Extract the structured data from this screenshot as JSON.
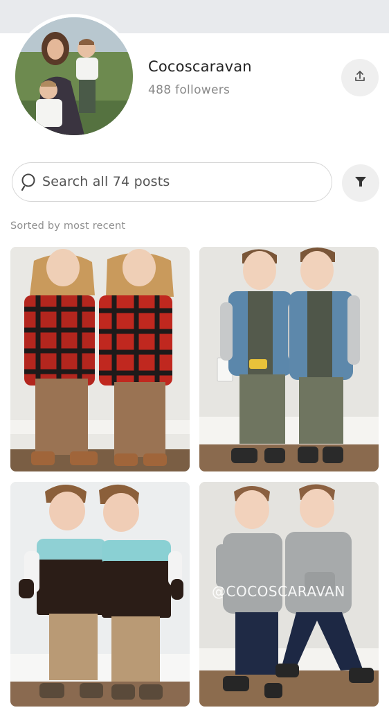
{
  "profile": {
    "name": "Cocoscaravan",
    "followers": "488 followers"
  },
  "search": {
    "placeholder": "Search all 74 posts"
  },
  "sort": {
    "label": "Sorted by most recent"
  },
  "posts": [
    {
      "watermark": ""
    },
    {
      "watermark": ""
    },
    {
      "watermark": ""
    },
    {
      "watermark": "@COCOSCARAVAN"
    }
  ],
  "icons": {
    "share": "share-icon",
    "search": "search-icon",
    "filter": "filter-icon"
  },
  "colors": {
    "topbar": "#e8eaed",
    "button_bg": "#efefef",
    "text_primary": "#222222",
    "text_secondary": "#8a8a8a"
  }
}
